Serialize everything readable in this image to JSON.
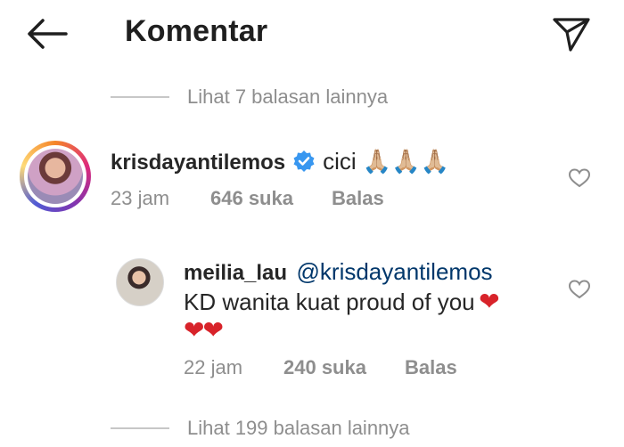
{
  "header": {
    "title": "Komentar",
    "back_icon": "arrow-left-icon",
    "send_icon": "send-icon"
  },
  "replies_top": {
    "text": "Lihat 7 balasan lainnya"
  },
  "comment1": {
    "username": "krisdayantilemos",
    "verified": true,
    "text": "cici 🙏🏼🙏🏼🙏🏼",
    "time": "23 jam",
    "likes": "646 suka",
    "reply": "Balas"
  },
  "comment2": {
    "username": "meilia_lau",
    "mention": "@krisdayantilemos",
    "text_line1": "KD wanita kuat proud of you",
    "heart_emoji": "❤",
    "text_line2": "❤❤",
    "time": "22 jam",
    "likes": "240 suka",
    "reply": "Balas"
  },
  "replies_bottom": {
    "text": "Lihat 199 balasan lainnya"
  },
  "colors": {
    "text": "#262626",
    "muted": "#8e8e8e",
    "verified": "#3897f0",
    "mention": "#00376b",
    "heart": "#d8232a"
  }
}
